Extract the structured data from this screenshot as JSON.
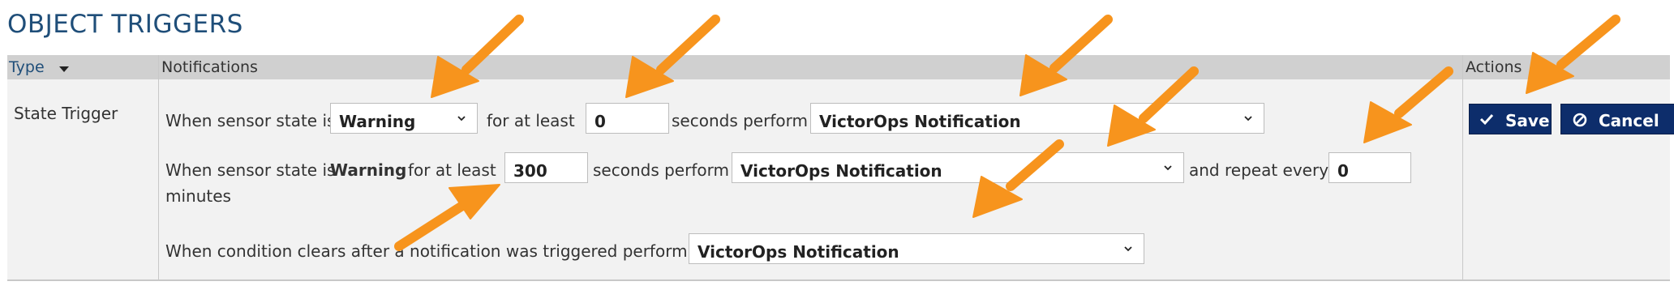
{
  "page": {
    "title": "OBJECT TRIGGERS"
  },
  "table": {
    "headers": {
      "type": "Type",
      "notifications": "Notifications",
      "actions": "Actions"
    },
    "type_value": "State Trigger"
  },
  "rule1": {
    "text1": "When sensor state is",
    "state_value": "Warning",
    "text2": "for at least",
    "seconds_value": "0",
    "text3": "seconds perform",
    "notification_value": "VictorOps Notification"
  },
  "rule2": {
    "text1": "When sensor state is",
    "state_bold": "Warning",
    "text2": "for at least",
    "seconds_value": "300",
    "text3": "seconds perform",
    "notification_value": "VictorOps Notification",
    "text4": "and repeat every",
    "repeat_value": "0",
    "text5": "minutes"
  },
  "rule3": {
    "text1": "When condition clears after a notification was triggered perform",
    "notification_value": "VictorOps Notification"
  },
  "actions": {
    "save_label": "Save",
    "cancel_label": "Cancel"
  },
  "colors": {
    "title": "#1f4e79",
    "button": "#0d2d6b",
    "arrow": "#f7941d",
    "header_bg": "#d0d0d0",
    "row_bg": "#f2f2f2"
  }
}
